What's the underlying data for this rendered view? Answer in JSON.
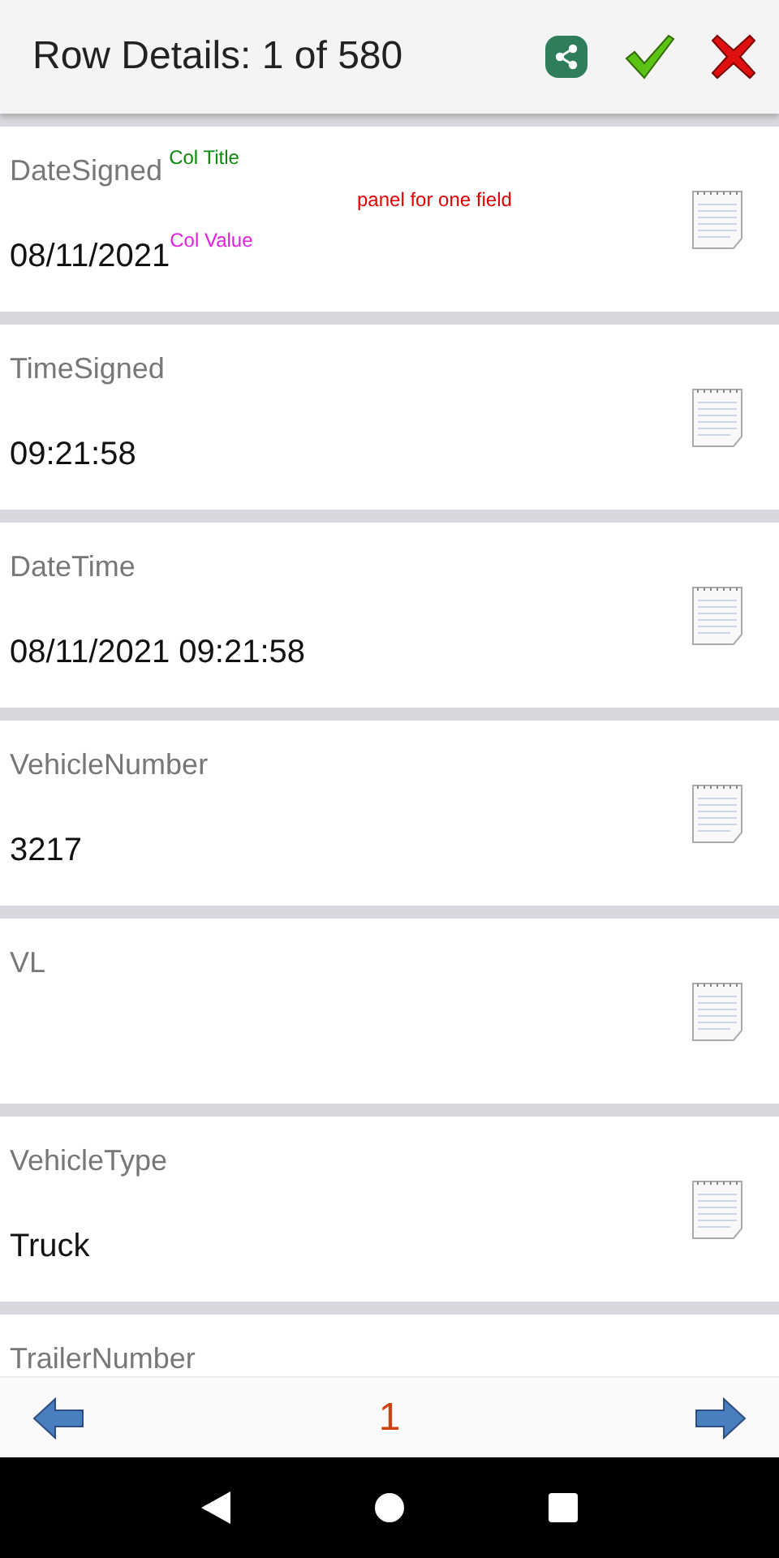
{
  "header": {
    "title": "Row Details: 1 of 580"
  },
  "fields": [
    {
      "title": "DateSigned",
      "value": "08/11/2021",
      "title_note": "Col Title",
      "value_note": "Col Value",
      "panel_note": "panel for one field"
    },
    {
      "title": "TimeSigned",
      "value": "09:21:58"
    },
    {
      "title": "DateTime",
      "value": "08/11/2021 09:21:58"
    },
    {
      "title": "VehicleNumber",
      "value": "3217"
    },
    {
      "title": "VL"
    },
    {
      "title": "VehicleType",
      "value": "Truck"
    },
    {
      "title": "TrailerNumber"
    }
  ],
  "pager": {
    "page": "1"
  }
}
